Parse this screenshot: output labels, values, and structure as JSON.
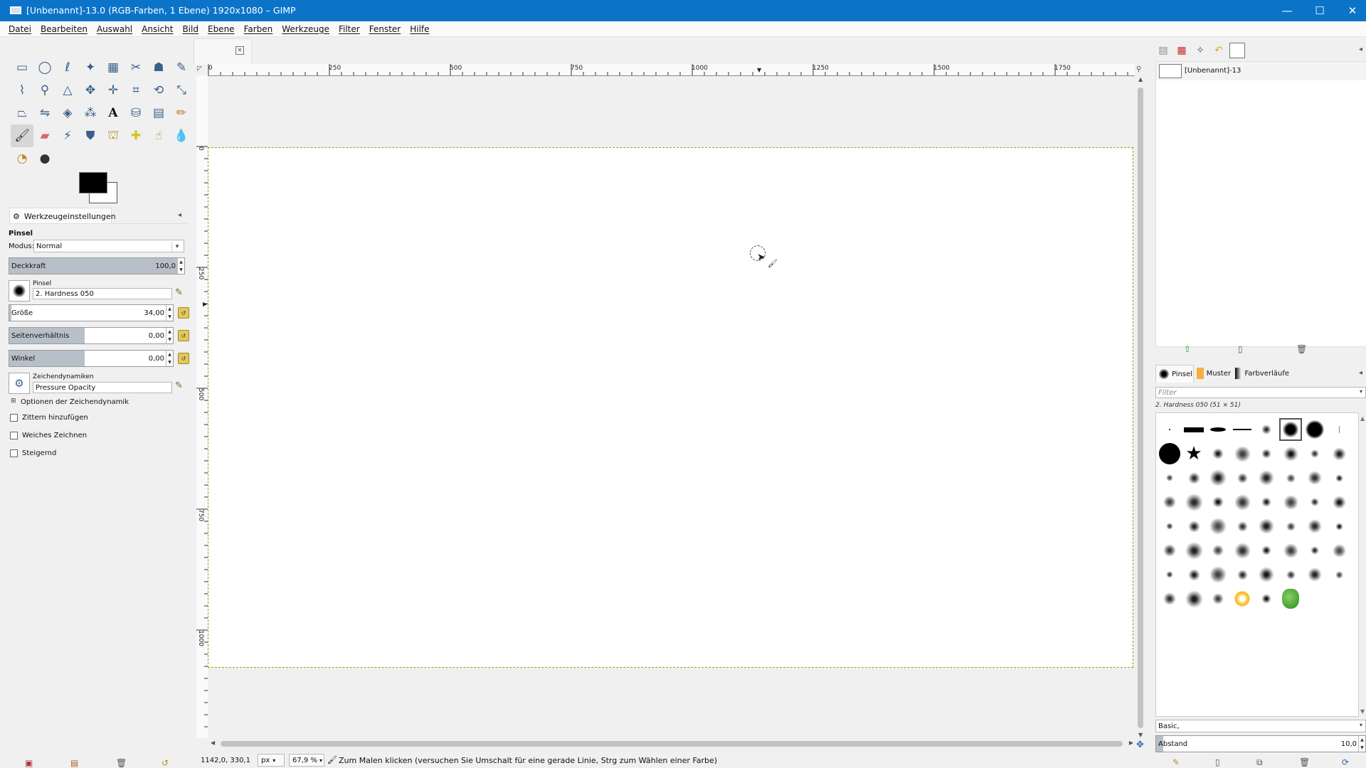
{
  "window": {
    "title": "[Unbenannt]-13.0 (RGB-Farben, 1 Ebene) 1920x1080 – GIMP",
    "minimize_glyph": "—",
    "maximize_glyph": "☐",
    "close_glyph": "✕"
  },
  "menu": [
    "Datei",
    "Bearbeiten",
    "Auswahl",
    "Ansicht",
    "Bild",
    "Ebene",
    "Farben",
    "Werkzeuge",
    "Filter",
    "Fenster",
    "Hilfe"
  ],
  "toolbox": {
    "tools": [
      "rect-select",
      "ellipse-select",
      "free-select",
      "fuzzy-select",
      "select-by-color",
      "scissors",
      "foreground-select",
      "paths",
      "color-picker",
      "zoom",
      "measure",
      "move",
      "align",
      "crop",
      "unified-transform",
      "warp-transform",
      "perspective",
      "flip",
      "cage-transform",
      "handle-transform",
      "text",
      "bucket-fill",
      "gradient",
      "pencil",
      "paintbrush",
      "eraser",
      "airbrush",
      "ink",
      "clone",
      "heal",
      "smudge",
      "blur-sharpen",
      "dodge-burn",
      "mypaint-brush"
    ],
    "active_tool": "paintbrush",
    "fg_color": "#000000",
    "bg_color": "#ffffff"
  },
  "tool_options": {
    "tab_label": "Werkzeugeinstellungen",
    "tool_name": "Pinsel",
    "mode_label": "Modus:",
    "mode_value": "Normal",
    "opacity_label": "Deckkraft",
    "opacity_value": "100,0",
    "brush_label": "Pinsel",
    "brush_value": "2. Hardness 050",
    "size_label": "Größe",
    "size_value": "34,00",
    "aspect_label": "Seitenverhältnis",
    "aspect_value": "0,00",
    "angle_label": "Winkel",
    "angle_value": "0,00",
    "dynamics_label": "Zeichendynamiken",
    "dynamics_value": "Pressure Opacity",
    "dynamics_options_label": "Optionen der Zeichendynamik",
    "checkbox_jitter": "Zittern hinzufügen",
    "checkbox_smooth": "Weiches Zeichnen",
    "checkbox_incremental": "Steigernd"
  },
  "ruler": {
    "h_labels": [
      "0",
      "250",
      "500",
      "750",
      "1000",
      "1250",
      "1500",
      "1750"
    ],
    "v_labels": [
      "0",
      "250",
      "500",
      "750",
      "1000"
    ]
  },
  "statusbar": {
    "coords": "1142,0, 330,1",
    "unit": "px",
    "zoom": "67,9 %",
    "message": "Zum Malen klicken (versuchen Sie Umschalt für eine gerade Linie, Strg zum Wählen einer Farbe)"
  },
  "right_dock": {
    "image_item": "[Unbenannt]-13",
    "tabs": {
      "brushes": "Pinsel",
      "patterns": "Muster",
      "gradients": "Farbverläufe"
    },
    "filter_placeholder": "Filter",
    "selected_brush_info": "2. Hardness 050 (51 × 51)",
    "tag_value": "Basic,",
    "spacing_label": "Abstand",
    "spacing_value": "10,0"
  }
}
